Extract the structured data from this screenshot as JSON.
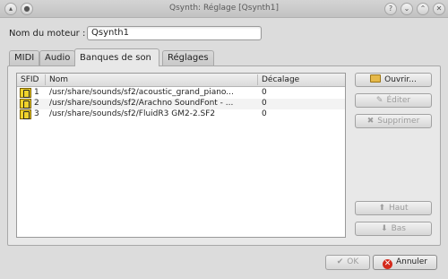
{
  "window": {
    "title": "Qsynth: Réglage [Qsynth1]",
    "help_glyph": "?",
    "minimize_glyph": "⌄",
    "maximize_glyph": "⌃",
    "close_glyph": "✕"
  },
  "engine": {
    "label": "Nom du moteur :",
    "value": "Qsynth1"
  },
  "tabs": [
    {
      "label": "MIDI",
      "active": false
    },
    {
      "label": "Audio",
      "active": false
    },
    {
      "label": "Banques de son",
      "active": true
    },
    {
      "label": "Réglages",
      "active": false
    }
  ],
  "soundfonts": {
    "columns": [
      "SFID",
      "Nom",
      "Décalage"
    ],
    "rows": [
      {
        "id": "1",
        "path": "/usr/share/sounds/sf2/acoustic_grand_piano...",
        "offset": "0"
      },
      {
        "id": "2",
        "path": "/usr/share/sounds/sf2/Arachno SoundFont - ...",
        "offset": "0"
      },
      {
        "id": "3",
        "path": "/usr/share/sounds/sf2/FluidR3 GM2-2.SF2",
        "offset": "0"
      }
    ]
  },
  "buttons": {
    "open": "Ouvrir...",
    "edit": "Éditer",
    "remove": "Supprimer",
    "up": "Haut",
    "down": "Bas",
    "ok": "OK",
    "cancel": "Annuler"
  },
  "icons": {
    "edit_glyph": "✎",
    "remove_glyph": "✖",
    "up_glyph": "⬆",
    "down_glyph": "⬇",
    "ok_glyph": "✔",
    "cancel_glyph": "✕"
  },
  "colors": {
    "cancel_icon": "#d42a1c",
    "soundfont_icon": "#f0d32c"
  }
}
